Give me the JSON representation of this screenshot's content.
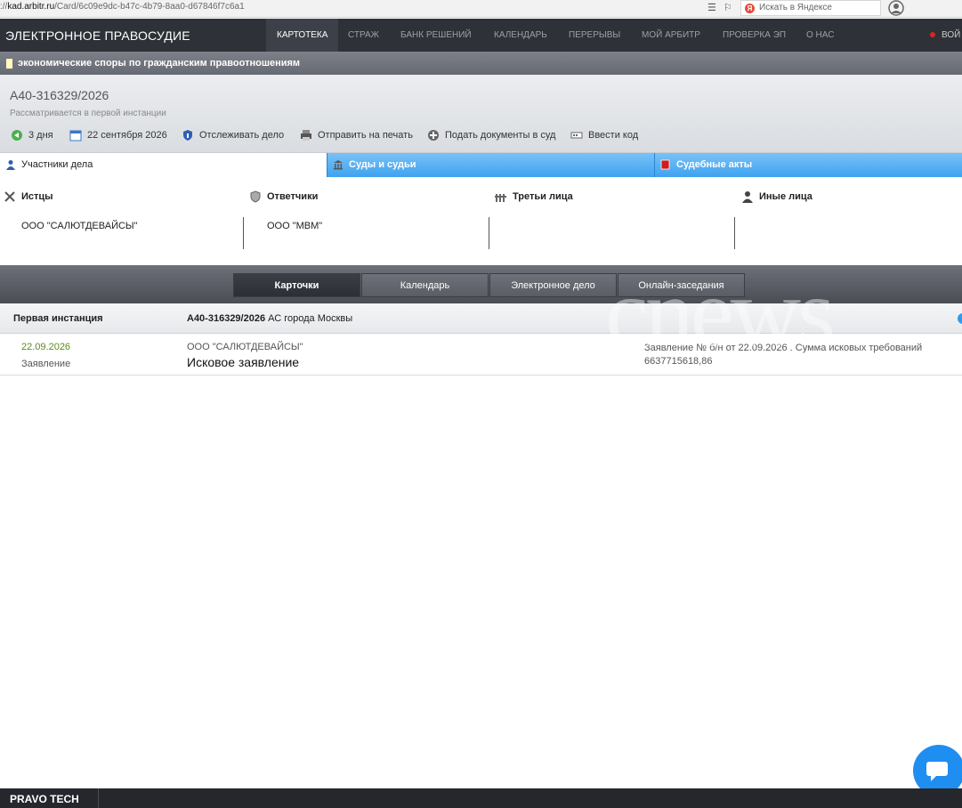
{
  "browser": {
    "url_prefix": "://",
    "url_domain": "kad.arbitr.ru",
    "url_path": "/Card/6c09e9dc-b47c-4b79-8aa0-d67846f7c6a1",
    "search_placeholder": "Искать в Яндексе",
    "yandex_logo": "Я"
  },
  "topnav": {
    "brand": "ЭЛЕКТРОННОЕ ПРАВОСУДИЕ",
    "items": [
      "КАРТОТЕКА",
      "СТРАЖ",
      "БАНК РЕШЕНИЙ",
      "КАЛЕНДАРЬ",
      "ПЕРЕРЫВЫ",
      "МОЙ АРБИТР",
      "ПРОВЕРКА ЭП",
      "О НАС"
    ],
    "login": "ВОЙ"
  },
  "category": "экономические споры по гражданским правоотношениям",
  "case": {
    "number": "А40-316329/2026",
    "status": "Рассматривается в первой инстанции",
    "tools": {
      "duration": "3 дня",
      "date": "22 сентября 2026",
      "track": "Отслеживать дело",
      "print": "Отправить на печать",
      "submit": "Подать документы в суд",
      "code": "Ввести код"
    }
  },
  "tabs": {
    "participants": "Участники дела",
    "courts": "Суды и судьи",
    "acts": "Судебные акты"
  },
  "participants": {
    "plaintiffs": {
      "label": "Истцы",
      "name": "ООО \"САЛЮТДЕВАЙСЫ\""
    },
    "defendants": {
      "label": "Ответчики",
      "name": "ООО \"МВМ\""
    },
    "third": {
      "label": "Третьи лица",
      "name": ""
    },
    "others": {
      "label": "Иные лица",
      "name": ""
    }
  },
  "subnav": [
    "Карточки",
    "Календарь",
    "Электронное дело",
    "Онлайн-заседания"
  ],
  "instance": {
    "title": "Первая инстанция",
    "case_number": "А40-316329/2026",
    "court": "АС города Москвы"
  },
  "entry": {
    "date": "22.09.2026",
    "type": "Заявление",
    "org": "ООО \"САЛЮТДЕВАЙСЫ\"",
    "title": "Исковое заявление",
    "description": "Заявление № б/н от 22.09.2026 . Сумма исковых требований 6637715618,86"
  },
  "watermark": "cnews",
  "footer": "PRAVO TECH"
}
